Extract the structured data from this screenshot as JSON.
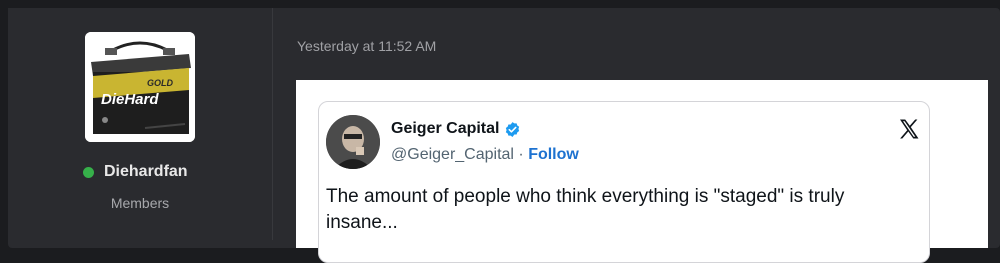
{
  "author": {
    "username": "Diehardfan",
    "user_title": "Members",
    "online": true,
    "avatar_text": {
      "brand": "DieHard",
      "grade": "GOLD"
    }
  },
  "post": {
    "timestamp": "Yesterday at 11:52 AM"
  },
  "tweet": {
    "display_name": "Geiger Capital",
    "handle": "@Geiger_Capital",
    "separator": " · ",
    "follow_label": "Follow",
    "text": "The amount of people who think everything is \"staged\" is truly insane...",
    "verified_icon": "verified-badge-icon",
    "platform_icon": "x-logo-icon"
  },
  "colors": {
    "page_bg": "#1b1c1f",
    "panel_bg": "#2a2b2f",
    "online": "#36b04a",
    "link_blue": "#1d72d0",
    "verified_blue": "#1d9bf0"
  }
}
